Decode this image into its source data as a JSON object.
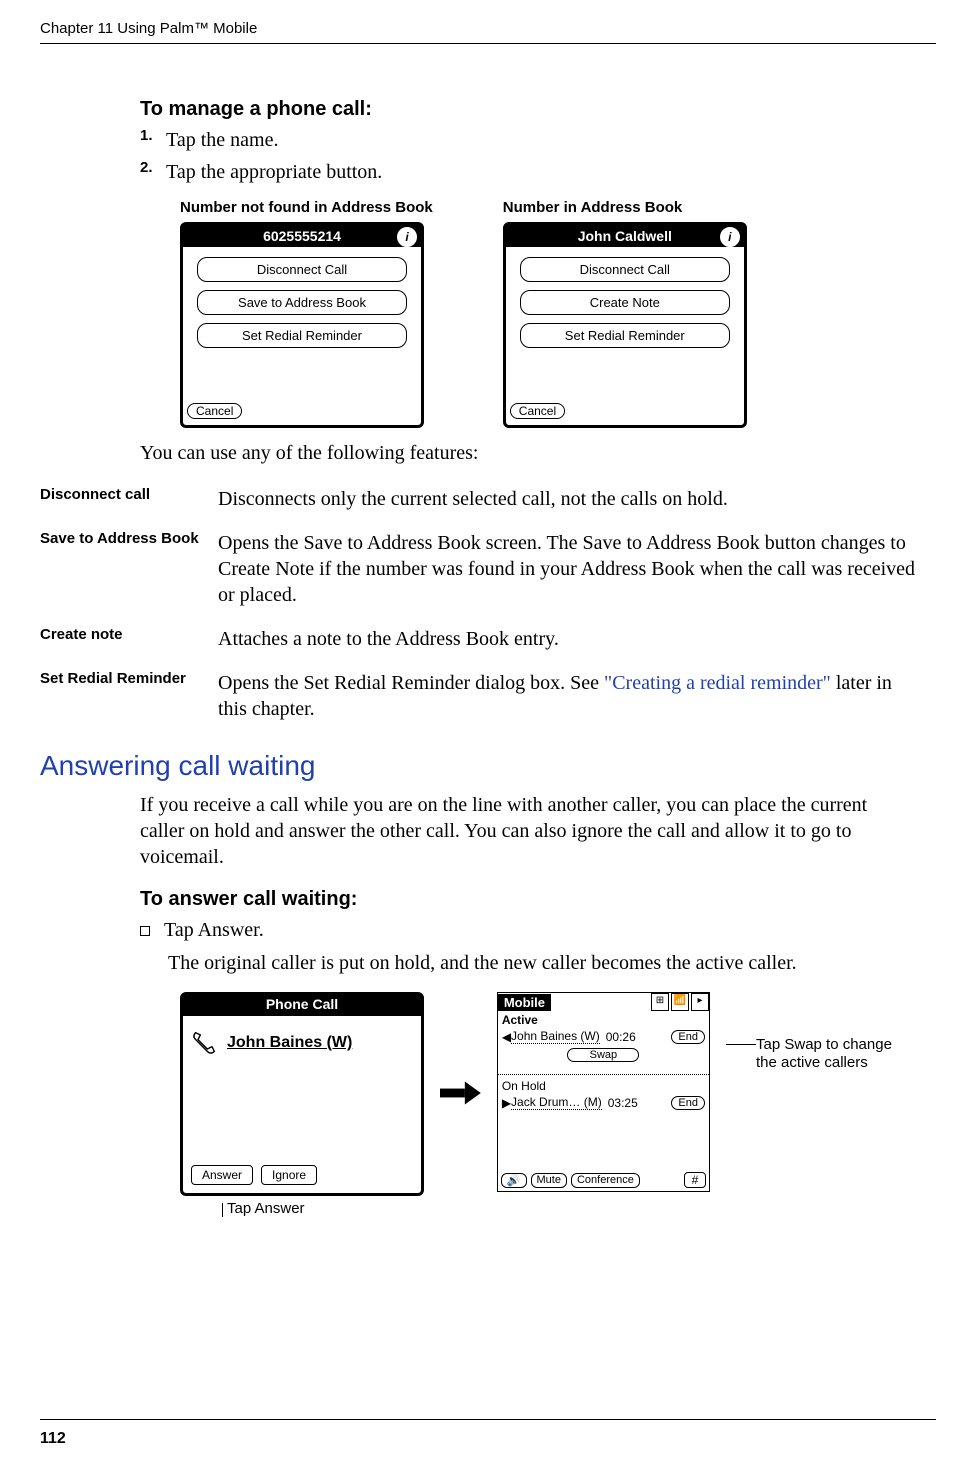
{
  "chapter_header": "Chapter 11   Using Palm™ Mobile",
  "page_number": "112",
  "manage_call": {
    "heading": "To manage a phone call:",
    "steps": [
      "Tap the name.",
      "Tap the appropriate button."
    ]
  },
  "screenshots": {
    "left_label": "Number not found in Address Book",
    "right_label": "Number in Address Book",
    "left": {
      "title": "6025555214",
      "buttons": [
        "Disconnect Call",
        "Save to Address Book",
        "Set Redial Reminder"
      ],
      "cancel": "Cancel"
    },
    "right": {
      "title": "John Caldwell",
      "buttons": [
        "Disconnect Call",
        "Create Note",
        "Set Redial Reminder"
      ],
      "cancel": "Cancel"
    }
  },
  "features_intro": "You can use any of the following features:",
  "features": [
    {
      "term": "Disconnect call",
      "desc_pre": "Disconnects only the current selected call, not the calls on hold.",
      "link": "",
      "desc_post": ""
    },
    {
      "term": "Save to Address Book",
      "desc_pre": "Opens the Save to Address Book screen. The Save to Address Book button changes to Create Note if the number was found in your Address Book when the call was received or placed.",
      "link": "",
      "desc_post": ""
    },
    {
      "term": "Create note",
      "desc_pre": "Attaches a note to the Address Book entry.",
      "link": "",
      "desc_post": ""
    },
    {
      "term": "Set Redial Reminder",
      "desc_pre": "Opens the Set Redial Reminder dialog box. See ",
      "link": "\"Creating a redial reminder\"",
      "desc_post": " later in this chapter."
    }
  ],
  "call_waiting": {
    "heading": "Answering call waiting",
    "para": "If you receive a call while you are on the line with another caller, you can place the current caller on hold and answer the other call. You can also ignore the call and allow it to go to voicemail.",
    "sub_heading": "To answer call waiting:",
    "bullet": "Tap Answer.",
    "result": "The original caller is put on hold, and the new caller becomes the active caller."
  },
  "incoming_call": {
    "title": "Phone Call",
    "caller": "John Baines (W)",
    "answer": "Answer",
    "ignore": "Ignore"
  },
  "mobile": {
    "title": "Mobile",
    "active_label": "Active",
    "active_name": "John Baines (W)",
    "active_time": "00:26",
    "end": "End",
    "swap": "Swap",
    "hold_label": "On Hold",
    "hold_name": "Jack Drum… (M)",
    "hold_time": "03:25",
    "mute": "Mute",
    "conference": "Conference",
    "hash": "#"
  },
  "callouts": {
    "swap": "Tap Swap to change the active callers",
    "answer": "Tap Answer"
  }
}
